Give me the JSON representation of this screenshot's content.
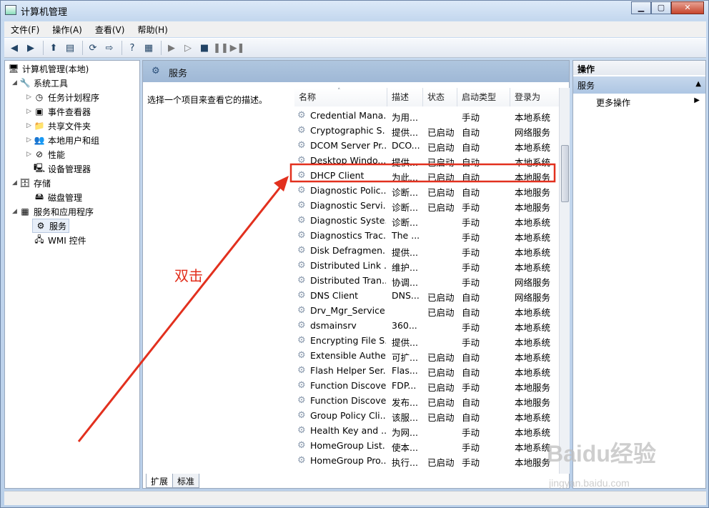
{
  "window": {
    "title": "计算机管理",
    "caption": {
      "minimize": "▁",
      "maximize": "▢",
      "close": "✕"
    }
  },
  "menu": [
    "文件(F)",
    "操作(A)",
    "查看(V)",
    "帮助(H)"
  ],
  "tree": [
    {
      "label": "计算机管理(本地)",
      "icon": "computer-icon"
    },
    {
      "label": "系统工具",
      "icon": "tools-icon",
      "expanded": true
    },
    {
      "label": "任务计划程序",
      "icon": "clock-icon"
    },
    {
      "label": "事件查看器",
      "icon": "event-viewer-icon"
    },
    {
      "label": "共享文件夹",
      "icon": "shared-folder-icon"
    },
    {
      "label": "本地用户和组",
      "icon": "users-icon"
    },
    {
      "label": "性能",
      "icon": "performance-icon"
    },
    {
      "label": "设备管理器",
      "icon": "device-manager-icon"
    },
    {
      "label": "存储",
      "icon": "storage-icon",
      "expanded": true
    },
    {
      "label": "磁盘管理",
      "icon": "disk-icon"
    },
    {
      "label": "服务和应用程序",
      "icon": "apps-icon",
      "expanded": true
    },
    {
      "label": "服务",
      "icon": "gear-icon",
      "selected": true
    },
    {
      "label": "WMI 控件",
      "icon": "wmi-icon"
    }
  ],
  "content": {
    "header_title": "服务",
    "description": "选择一个项目来查看它的描述。",
    "columns": [
      "名称",
      "描述",
      "状态",
      "启动类型",
      "登录为"
    ],
    "rows": [
      [
        "Credential Mana...",
        "为用...",
        "",
        "手动",
        "本地系统"
      ],
      [
        "Cryptographic S...",
        "提供...",
        "已启动",
        "自动",
        "网络服务"
      ],
      [
        "DCOM Server Pr...",
        "DCO...",
        "已启动",
        "自动",
        "本地系统"
      ],
      [
        "Desktop Windo...",
        "提供...",
        "已启动",
        "自动",
        "本地系统"
      ],
      [
        "DHCP Client",
        "为此...",
        "已启动",
        "自动",
        "本地服务"
      ],
      [
        "Diagnostic Polic...",
        "诊断...",
        "已启动",
        "自动",
        "本地服务"
      ],
      [
        "Diagnostic Servi...",
        "诊断...",
        "已启动",
        "手动",
        "本地服务"
      ],
      [
        "Diagnostic Syste...",
        "诊断...",
        "",
        "手动",
        "本地系统"
      ],
      [
        "Diagnostics Trac...",
        "The ...",
        "",
        "手动",
        "本地系统"
      ],
      [
        "Disk Defragmen...",
        "提供...",
        "",
        "手动",
        "本地系统"
      ],
      [
        "Distributed Link ...",
        "维护...",
        "",
        "手动",
        "本地系统"
      ],
      [
        "Distributed Tran...",
        "协调...",
        "",
        "手动",
        "网络服务"
      ],
      [
        "DNS Client",
        "DNS...",
        "已启动",
        "自动",
        "网络服务"
      ],
      [
        "Drv_Mgr_Service",
        "",
        "已启动",
        "自动",
        "本地系统"
      ],
      [
        "dsmainsrv",
        "360...",
        "",
        "手动",
        "本地系统"
      ],
      [
        "Encrypting File S...",
        "提供...",
        "",
        "手动",
        "本地系统"
      ],
      [
        "Extensible Authe...",
        "可扩...",
        "已启动",
        "自动",
        "本地系统"
      ],
      [
        "Flash Helper Ser...",
        "Flas...",
        "已启动",
        "自动",
        "本地系统"
      ],
      [
        "Function Discove...",
        "FDP...",
        "已启动",
        "手动",
        "本地服务"
      ],
      [
        "Function Discove...",
        "发布...",
        "已启动",
        "自动",
        "本地服务"
      ],
      [
        "Group Policy Cli...",
        "该服...",
        "已启动",
        "自动",
        "本地系统"
      ],
      [
        "Health Key and ...",
        "为网...",
        "",
        "手动",
        "本地系统"
      ],
      [
        "HomeGroup List...",
        "使本...",
        "",
        "手动",
        "本地系统"
      ],
      [
        "HomeGroup Pro...",
        "执行...",
        "已启动",
        "手动",
        "本地服务"
      ]
    ],
    "highlighted_row": "DHCP Client",
    "tabs": [
      "扩展",
      "标准"
    ]
  },
  "actions": {
    "header": "操作",
    "section": "服务",
    "item": "更多操作"
  },
  "annotation": {
    "label": "双击",
    "color": "#e2301e"
  },
  "watermark": {
    "brand": "Baidu经验",
    "url": "jingyan.baidu.com"
  }
}
